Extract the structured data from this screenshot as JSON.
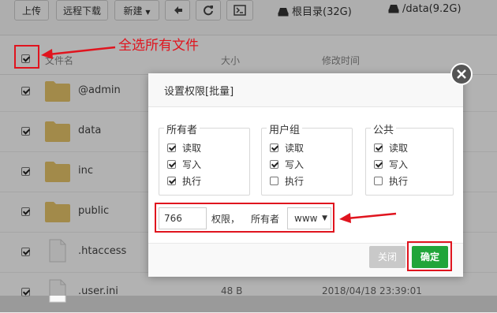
{
  "toolbar": {
    "upload": "上传",
    "remote_download": "远程下载",
    "new": "新建",
    "disk_root": "根目录(32G)",
    "disk_data": "/data(9.2G)"
  },
  "annotation": "全选所有文件",
  "table": {
    "headers": [
      "文件名",
      "大小",
      "修改时间"
    ],
    "rows": [
      {
        "name": "@admin",
        "type": "folder",
        "size": "",
        "date": ""
      },
      {
        "name": "data",
        "type": "folder",
        "size": "",
        "date": ""
      },
      {
        "name": "inc",
        "type": "folder",
        "size": "",
        "date": ""
      },
      {
        "name": "public",
        "type": "folder",
        "size": "",
        "date": ""
      },
      {
        "name": ".htaccess",
        "type": "file",
        "size": "",
        "date": ""
      },
      {
        "name": ".user.ini",
        "type": "file",
        "size": "48 B",
        "date": "2018/04/18 23:39:01"
      }
    ]
  },
  "dialog": {
    "title": "设置权限[批量]",
    "groups": [
      {
        "label": "所有者",
        "perms": [
          {
            "label": "读取",
            "checked": true
          },
          {
            "label": "写入",
            "checked": true
          },
          {
            "label": "执行",
            "checked": true
          }
        ]
      },
      {
        "label": "用户组",
        "perms": [
          {
            "label": "读取",
            "checked": true
          },
          {
            "label": "写入",
            "checked": true
          },
          {
            "label": "执行",
            "checked": false
          }
        ]
      },
      {
        "label": "公共",
        "perms": [
          {
            "label": "读取",
            "checked": true
          },
          {
            "label": "写入",
            "checked": true
          },
          {
            "label": "执行",
            "checked": false
          }
        ]
      }
    ],
    "permission_value": "766",
    "permission_label": "权限，",
    "owner_label": "所有者",
    "owner_value": "www",
    "close_button": "关闭",
    "confirm_button": "确定"
  },
  "colors": {
    "accent_red": "#e0141e",
    "confirm_green": "#20a53a"
  }
}
